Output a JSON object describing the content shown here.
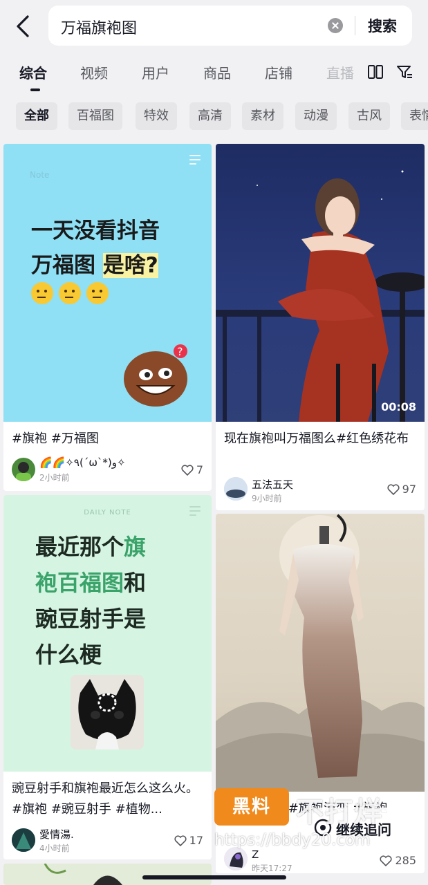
{
  "search": {
    "query": "万福旗袍图",
    "button": "搜索"
  },
  "tabs": [
    {
      "label": "综合"
    },
    {
      "label": "视频"
    },
    {
      "label": "用户"
    },
    {
      "label": "商品"
    },
    {
      "label": "店铺"
    },
    {
      "label": "直播"
    }
  ],
  "chips": [
    {
      "label": "全部"
    },
    {
      "label": "百福图"
    },
    {
      "label": "特效"
    },
    {
      "label": "高清"
    },
    {
      "label": "素材"
    },
    {
      "label": "动漫"
    },
    {
      "label": "古风"
    },
    {
      "label": "表情"
    }
  ],
  "cards": [
    {
      "cover_lines": [
        "一天没看抖音",
        "万福图 ",
        "是啥?"
      ],
      "note_label": "Note",
      "title": "#旗袍 #万福图",
      "author": "🌈🌈✧٩(ˊωˋ*)و✧",
      "time": "2小时前",
      "likes": "7"
    },
    {
      "duration": "00:08",
      "title": "现在旗袍叫万福图么#红色绣花布",
      "author": "五法五天",
      "time": "9小时前",
      "likes": "97"
    },
    {
      "daily_label": "DAILY NOTE",
      "cover_lines": [
        "最近那个",
        "旗",
        "袍百福图",
        "和",
        "豌豆射手是",
        "什么梗"
      ],
      "title": "豌豆射手和旗袍最近怎么这么火。#旗袍 #豌豆射手 #植物...",
      "author": "愛情湯.",
      "time": "4小时前",
      "likes": "17"
    },
    {
      "title": "#手绘旗袍 #旗袍演变 #旗袍",
      "author": "Z",
      "time": "昨天17:27",
      "likes": "285"
    }
  ],
  "overlay": {
    "continue_label": "继续追问",
    "watermark_logo": "黑料",
    "watermark_text": "不打烊",
    "watermark_url": "https://bbdy20.com"
  },
  "colors": {
    "page_bg": "#f1f1f3",
    "chip_bg": "#e6e6e8",
    "watermark_orange": "#f08a1c"
  }
}
